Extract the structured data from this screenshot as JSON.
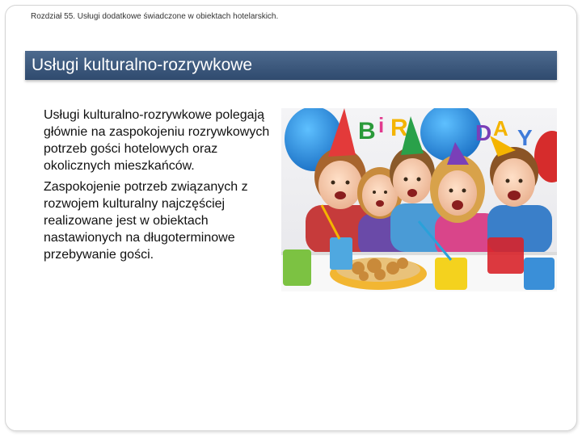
{
  "header": {
    "chapter": "Rozdział 55. Usługi dodatkowe świadczone w obiektach hotelarskich."
  },
  "slide": {
    "title": "Usługi kulturalno-rozrywkowe",
    "paragraphs": [
      "Usługi kulturalno-rozrywkowe polegają głównie na zaspokojeniu rozrywkowych potrzeb gości hotelowych oraz okolicznych mieszkańców.",
      "Zaspokojenie potrzeb związanych z rozwojem kulturalny najczęściej realizowane jest w obiektach nastawionych na długoterminowe przebywanie gości."
    ]
  },
  "image": {
    "letters": [
      "B",
      "i",
      "R",
      "D",
      "A",
      "Y"
    ]
  }
}
